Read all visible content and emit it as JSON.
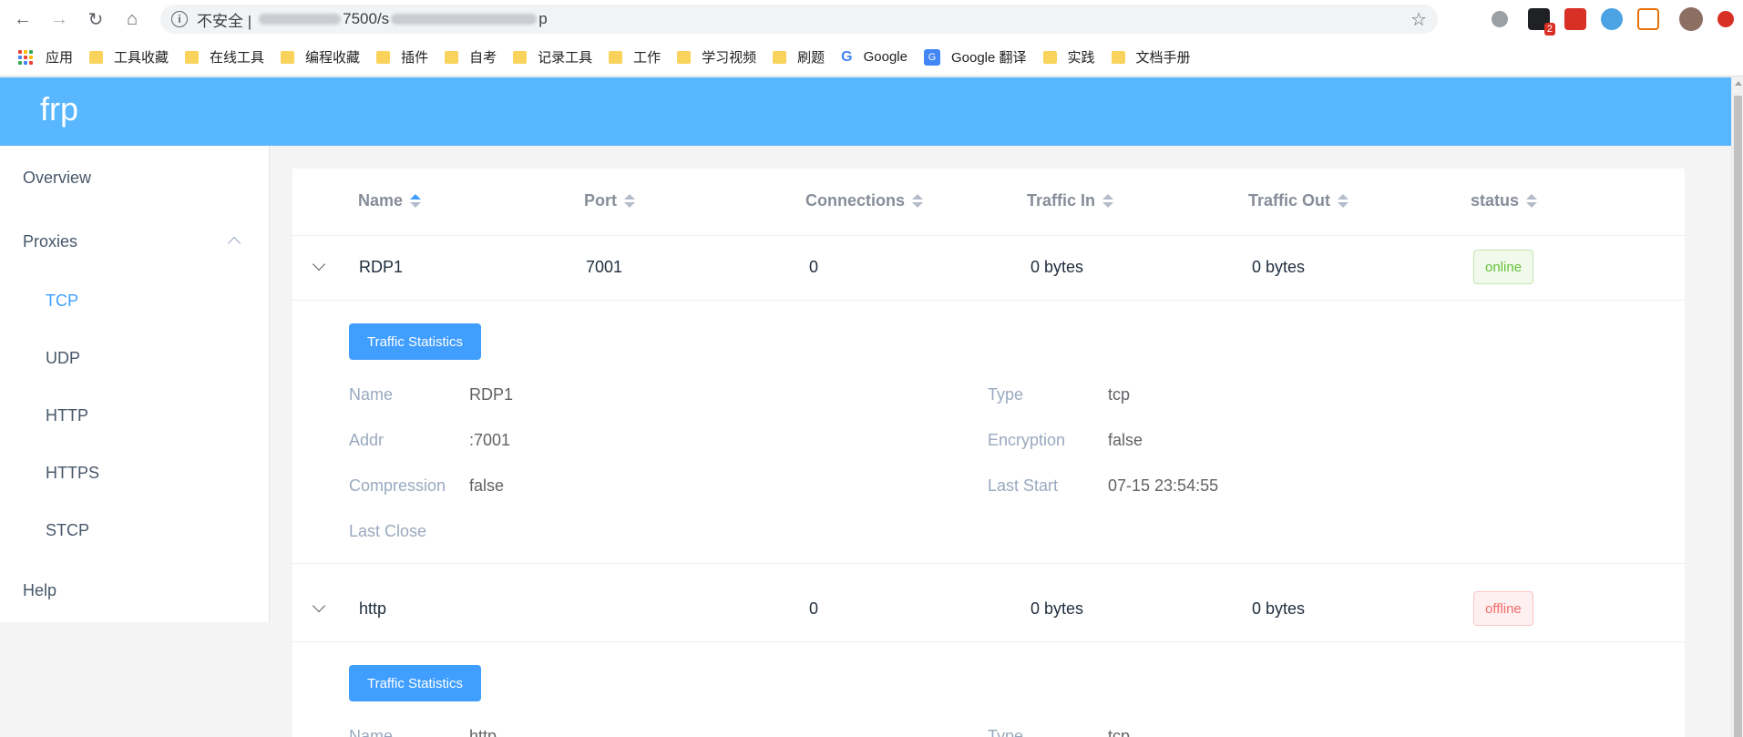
{
  "browser": {
    "url_prefix": "不安全 |",
    "url_visible": "7500/s",
    "url_tail": "p",
    "bookmarks": [
      {
        "label": "应用",
        "icon": "apps-grid-icon"
      },
      {
        "label": "工具收藏",
        "icon": "folder-icon"
      },
      {
        "label": "在线工具",
        "icon": "folder-icon"
      },
      {
        "label": "编程收藏",
        "icon": "folder-icon"
      },
      {
        "label": "插件",
        "icon": "folder-icon"
      },
      {
        "label": "自考",
        "icon": "folder-icon"
      },
      {
        "label": "记录工具",
        "icon": "folder-icon"
      },
      {
        "label": "工作",
        "icon": "folder-icon"
      },
      {
        "label": "学习视频",
        "icon": "folder-icon"
      },
      {
        "label": "刷题",
        "icon": "folder-icon"
      },
      {
        "label": "Google",
        "icon": "google-icon"
      },
      {
        "label": "Google 翻译",
        "icon": "google-translate-icon"
      },
      {
        "label": "实践",
        "icon": "folder-icon"
      },
      {
        "label": "文档手册",
        "icon": "folder-icon"
      }
    ],
    "extension_badge": "2"
  },
  "app": {
    "brand": "frp",
    "accent": "#58b7ff"
  },
  "sidebar": {
    "overview": "Overview",
    "proxies": "Proxies",
    "sub": [
      "TCP",
      "UDP",
      "HTTP",
      "HTTPS",
      "STCP"
    ],
    "active": "TCP",
    "help": "Help"
  },
  "table": {
    "columns": [
      "Name",
      "Port",
      "Connections",
      "Traffic In",
      "Traffic Out",
      "status"
    ],
    "rows": [
      {
        "name": "RDP1",
        "port": "7001",
        "connections": "0",
        "traffic_in": "0 bytes",
        "traffic_out": "0 bytes",
        "status": "online",
        "detail": {
          "button": "Traffic Statistics",
          "labels": {
            "name": "Name",
            "addr": "Addr",
            "compression": "Compression",
            "last_close": "Last Close",
            "type": "Type",
            "encryption": "Encryption",
            "last_start": "Last Start"
          },
          "values": {
            "name": "RDP1",
            "addr": ":7001",
            "compression": "false",
            "last_close": "",
            "type": "tcp",
            "encryption": "false",
            "last_start": "07-15 23:54:55"
          }
        }
      },
      {
        "name": "http",
        "port": "",
        "connections": "0",
        "traffic_in": "0 bytes",
        "traffic_out": "0 bytes",
        "status": "offline",
        "detail": {
          "button": "Traffic Statistics",
          "labels": {
            "name": "Name",
            "type": "Type"
          },
          "values": {
            "name": "http",
            "type": "tcp"
          }
        }
      }
    ]
  }
}
